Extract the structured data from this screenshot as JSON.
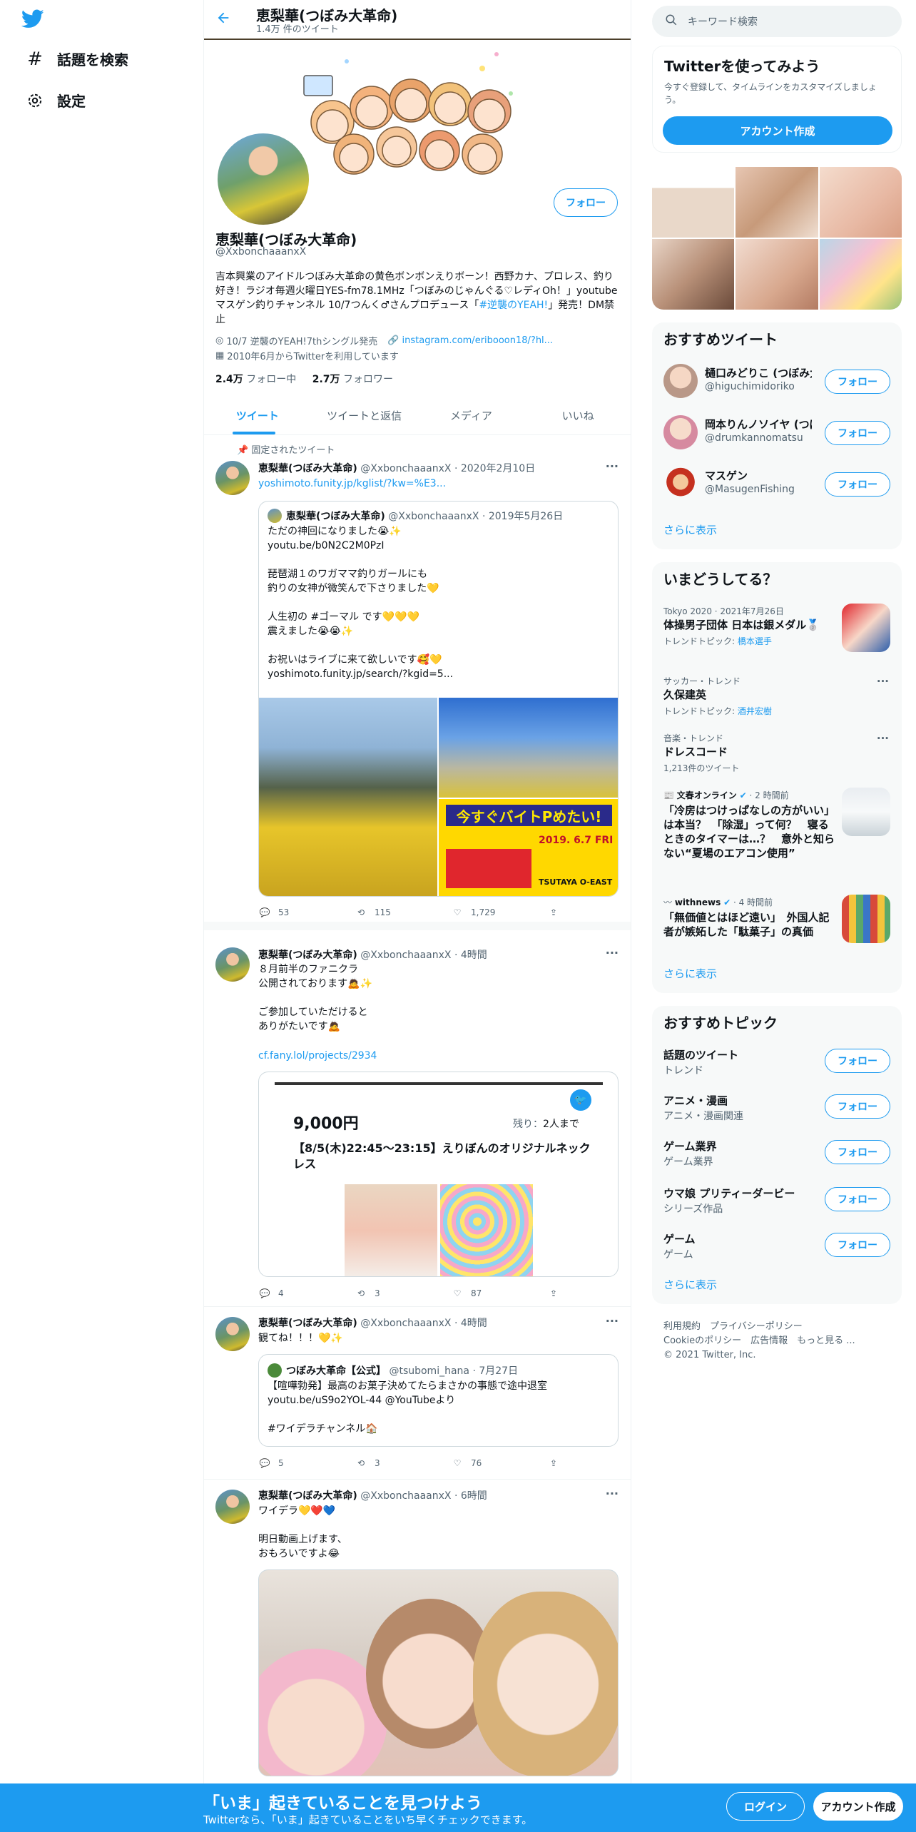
{
  "nav": {
    "explore": "話題を検索",
    "settings": "設定"
  },
  "header": {
    "name": "恵梨華(つぼみ大革命)",
    "tweet_count": "1.4万 件のツイート"
  },
  "profile": {
    "name": "恵梨華(つぼみ大革命)",
    "handle": "@XxbonchaaanxX",
    "follow": "フォロー",
    "bio_text": "吉本興業のアイドルつぼみ大革命の黄色ボンボンえりボーン！西野カナ、プロレス、釣り好き！ラジオ毎週火曜日YES-fm78.1MHz「つぼみのじゃんぐる♡レディOh！」youtube マスゲン釣りチャンネル 10/7つんく♂さんプロデュース「",
    "bio_hashtag": "#逆襲のYEAH!",
    "bio_tail": "」発売！DM禁止",
    "location": "10/7 逆襲のYEAH!7thシングル発売",
    "url": "instagram.com/eribooon18/?hl...",
    "joined": "2010年6月からTwitterを利用しています",
    "following_num": "2.4万",
    "following_label": " フォロー中",
    "followers_num": "2.7万",
    "followers_label": " フォロワー"
  },
  "tabs": [
    "ツイート",
    "ツイートと返信",
    "メディア",
    "いいね"
  ],
  "tweets": [
    {
      "pinned": "固定されたツイート",
      "name": "恵梨華(つぼみ大革命)",
      "handle": "@XxbonchaaanxX",
      "time": "· 2020年2月10日",
      "link": "yoshimoto.funity.jp/kglist/?kw=%E3...",
      "quote": {
        "name": "恵梨華(つぼみ大革命)",
        "handle": "@XxbonchaaanxX",
        "time": "· 2019年5月26日",
        "text": "ただの神回になりました😭✨\nyoutu.be/b0N2C2M0PzI\n\n琵琶湖１のワガママ釣りガールにも\n釣りの女神が微笑んで下さりました💛\n\n人生初の #ゴーマル です💛💛💛\n震えました😭😭✨\n\nお祝いはライブに来て欲しいです🥰💛\nyoshimoto.funity.jp/search/?kgid=5...",
        "poster_date": "2019. 6.7 FRI",
        "poster_venue": "TSUTAYA O-EAST",
        "poster_title": "今すぐバイトPめたい!"
      },
      "replies": "53",
      "retweets": "115",
      "likes": "1,729"
    },
    {
      "name": "恵梨華(つぼみ大革命)",
      "handle": "@XxbonchaaanxX",
      "time": "· 4時間",
      "text": "８月前半のファニクラ\n公開されております🙇✨\n\nご参加していただけると\nありがたいです🙇",
      "link": "cf.fany.lol/projects/2934",
      "card": {
        "price": "9,000円",
        "remain_label": "残り：",
        "remain": "2人まで",
        "title": "【8/5(木)22:45〜23:15】えりぼんのオリジナルネックレス"
      },
      "replies": "4",
      "retweets": "3",
      "likes": "87"
    },
    {
      "name": "恵梨華(つぼみ大革命)",
      "handle": "@XxbonchaaanxX",
      "time": "· 4時間",
      "text": "観てね！！！💛✨",
      "quote": {
        "name": "つぼみ大革命【公式】",
        "handle": "@tsubomi_hana",
        "time": "· 7月27日",
        "text": "【喧嘩勃発】最高のお菓子決めてたらまさかの事態で途中退室\nyoutu.be/uS9o2YOL-44 @YouTubeより\n\n#ワイデラチャンネル🏠"
      },
      "replies": "5",
      "retweets": "3",
      "likes": "76"
    },
    {
      "name": "恵梨華(つぼみ大革命)",
      "handle": "@XxbonchaaanxX",
      "time": "· 6時間",
      "text": "ワイデラ💛❤️💙\n\n明日動画上げます、\nおもろいですよ😂"
    }
  ],
  "search": {
    "placeholder": "キーワード検索"
  },
  "signup": {
    "title": "Twitterを使ってみよう",
    "desc": "今すぐ登録して、タイムラインをカスタマイズしましょう。",
    "button": "アカウント作成"
  },
  "who_to_follow": {
    "title": "おすすめツイート",
    "follow": "フォロー",
    "more": "さらに表示",
    "users": [
      {
        "name": "樋口みどりこ (つぼみ大",
        "handle": "@higuchimidoriko"
      },
      {
        "name": "岡本りんノソイヤ (つぼみ",
        "handle": "@drumkannomatsu"
      },
      {
        "name": "マスゲン",
        "handle": "@MasugenFishing"
      }
    ]
  },
  "trends": {
    "title": "いまどうしてる？",
    "more": "さらに表示",
    "items": [
      {
        "cat": "Tokyo 2020 · 2021年7月26日",
        "title": "体操男子団体 日本は銀メダル🥈",
        "sub_label": "トレンドトピック: ",
        "sub_link": "橋本選手"
      },
      {
        "cat": "サッカー・トレンド",
        "title": "久保建英",
        "sub_label": "トレンドトピック: ",
        "sub_link": "酒井宏樹"
      },
      {
        "cat": "音楽・トレンド",
        "title": "ドレスコード",
        "sub_label": "1,213件のツイート",
        "sub_link": ""
      },
      {
        "cat_src": "文春オンライン",
        "cat_time": "· 2 時間前",
        "title": "「冷房はつけっぱなしの方がいい」は本当？　「除湿」って何？　寝るときのタイマーは…？　意外と知らない“夏場のエアコン使用”"
      },
      {
        "cat_src": "withnews",
        "cat_time": "· 4 時間前",
        "title": "「無価値とはほど遠い」　外国人記者が嫉妬した「駄菓子」の真価"
      }
    ]
  },
  "topics": {
    "title": "おすすめトピック",
    "follow": "フォロー",
    "more": "さらに表示",
    "items": [
      {
        "title": "話題のツイート",
        "sub": "トレンド"
      },
      {
        "title": "アニメ・漫画",
        "sub": "アニメ・漫画関連"
      },
      {
        "title": "ゲーム業界",
        "sub": "ゲーム業界"
      },
      {
        "title": "ウマ娘 プリティーダービー",
        "sub": "シリーズ作品"
      },
      {
        "title": "ゲーム",
        "sub": "ゲーム"
      }
    ]
  },
  "footer": {
    "l1": "利用規約　プライバシーポリシー",
    "l2": "Cookieのポリシー　広告情報　もっと見る ...",
    "l3": "© 2021 Twitter, Inc."
  },
  "bottom": {
    "title": "「いま」起きていることを見つけよう",
    "sub": "Twitterなら、「いま」起きていることをいち早くチェックできます。",
    "login": "ログイン",
    "signup": "アカウント作成"
  },
  "colors": {
    "accent": "#1d9bf0"
  }
}
